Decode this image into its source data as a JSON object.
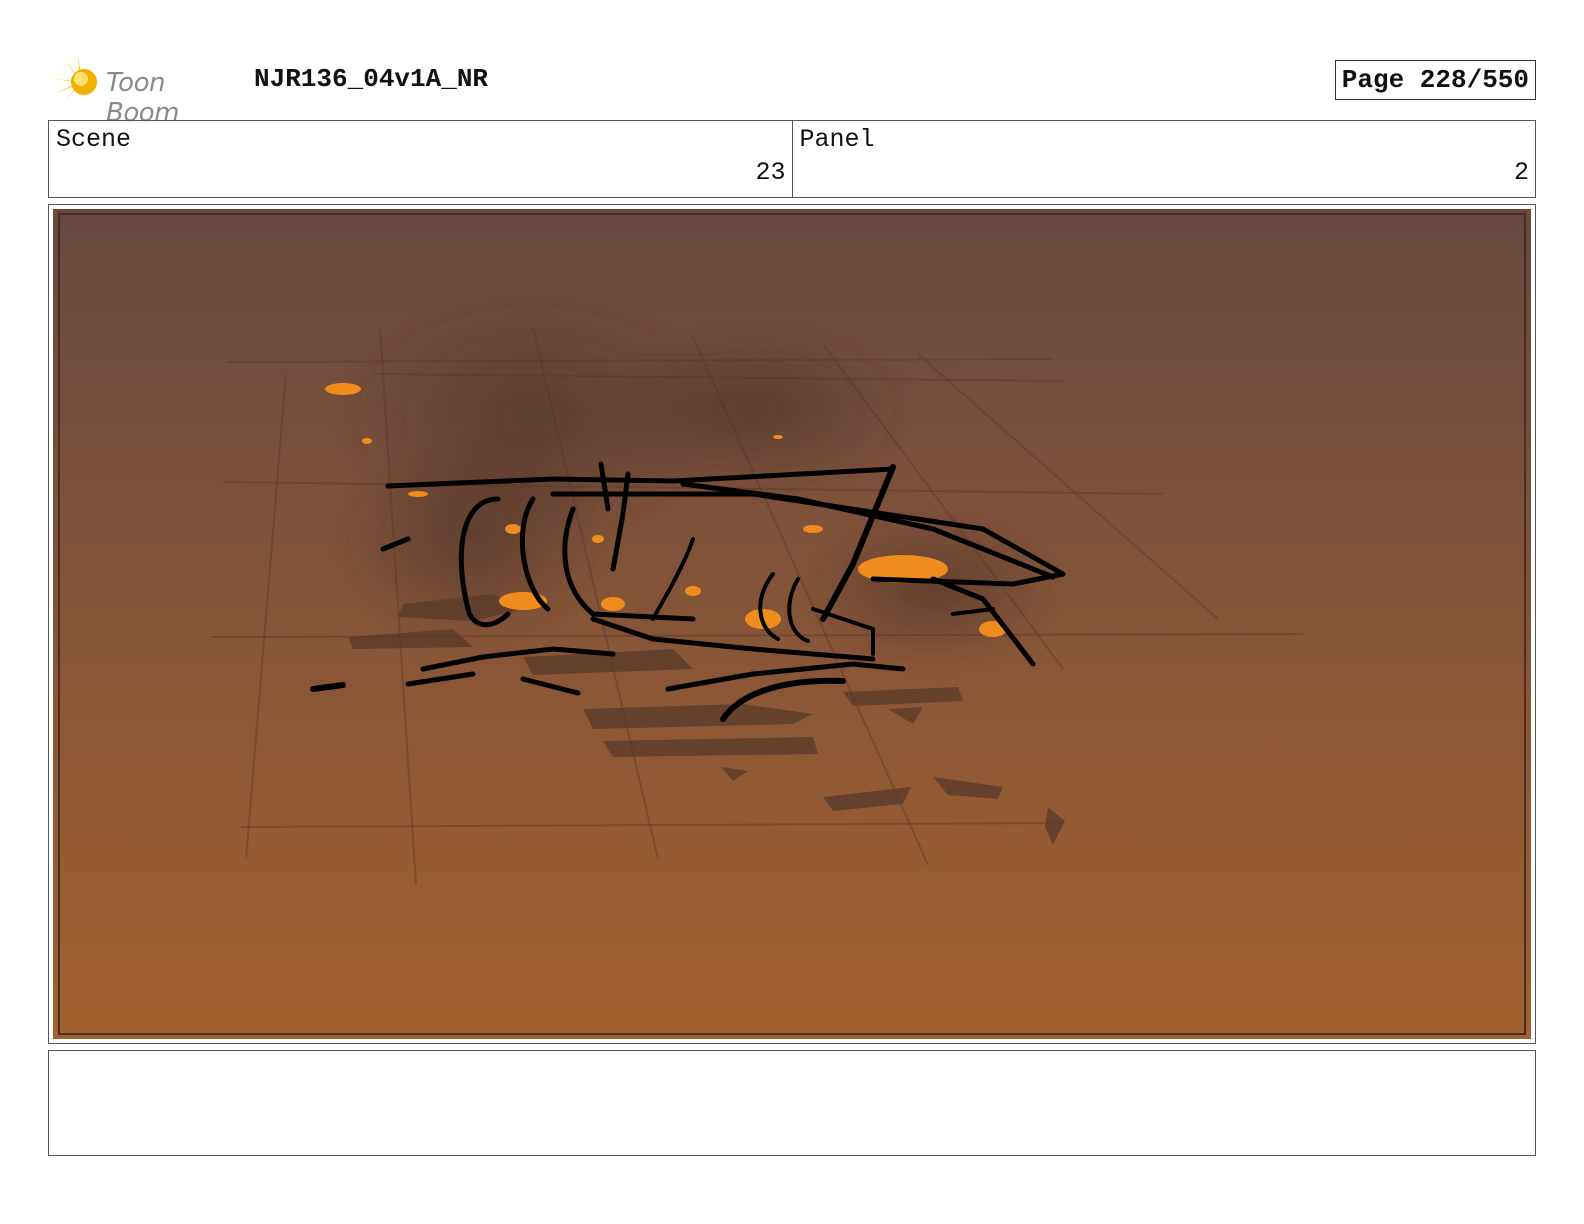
{
  "header": {
    "logo_text": "Toon Boom",
    "title": "NJR136_04v1A_NR",
    "page_label": "Page 228/550"
  },
  "scene": {
    "label": "Scene",
    "value": "23"
  },
  "panel": {
    "label": "Panel",
    "value": "2"
  },
  "notes": {
    "text": ""
  },
  "colors": {
    "frame_top": "#6a4a40",
    "frame_bottom": "#9e5f30",
    "ember": "#f08c1e",
    "ink": "#000000",
    "logo_yellow": "#f6c21b"
  },
  "icons": {
    "logo": "toon-boom-starburst-icon"
  }
}
